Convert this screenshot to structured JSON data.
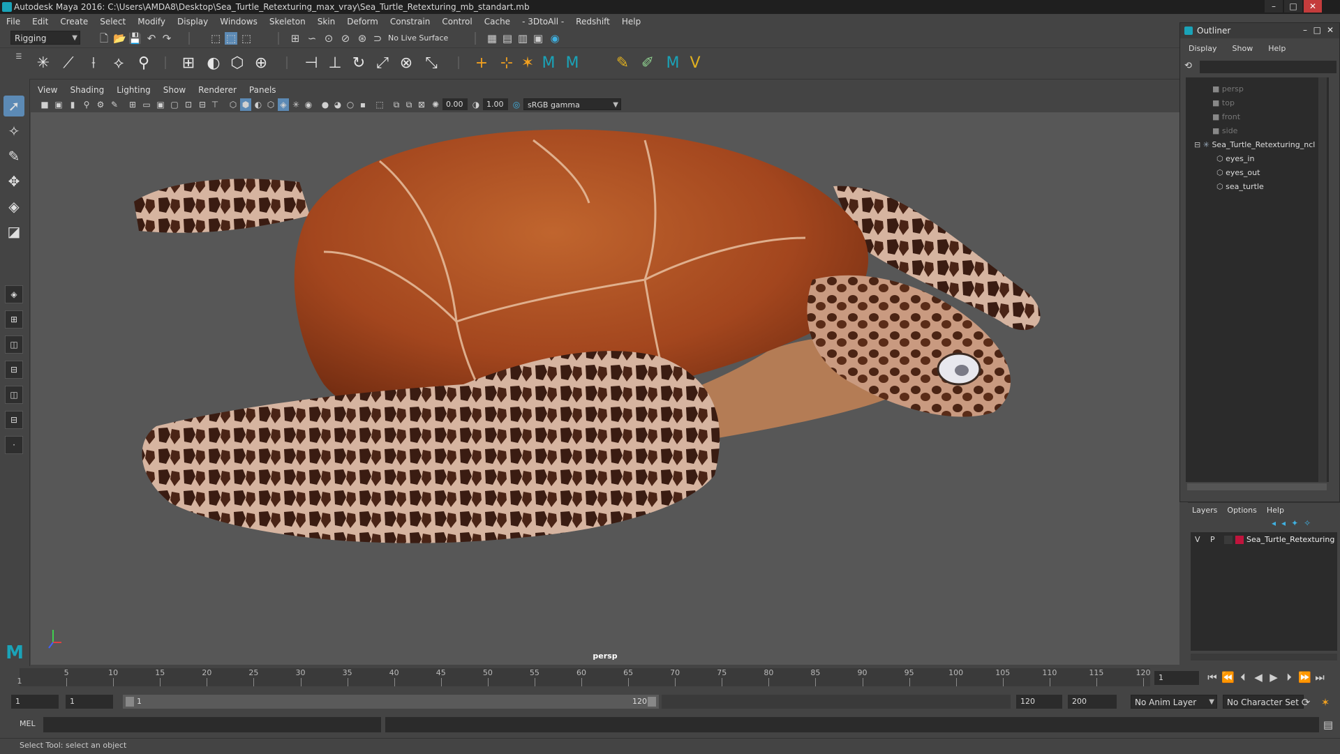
{
  "window": {
    "title": "Autodesk Maya 2016: C:\\Users\\AMDA8\\Desktop\\Sea_Turtle_Retexturing_max_vray\\Sea_Turtle_Retexturing_mb_standart.mb",
    "minimize": "–",
    "maximize": "□",
    "close": "✕"
  },
  "menubar": [
    "File",
    "Edit",
    "Create",
    "Select",
    "Modify",
    "Display",
    "Windows",
    "Skeleton",
    "Skin",
    "Deform",
    "Constrain",
    "Control",
    "Cache",
    "- 3DtoAll -",
    "Redshift",
    "Help"
  ],
  "statusline": {
    "menuset": "Rigging",
    "live_surface": "No Live Surface"
  },
  "viewport": {
    "menu": [
      "View",
      "Shading",
      "Lighting",
      "Show",
      "Renderer",
      "Panels"
    ],
    "exposure": "0.00",
    "gamma": "1.00",
    "colorspace": "sRGB gamma",
    "camera_label": "persp"
  },
  "timeline": {
    "ticks": [
      5,
      10,
      15,
      20,
      25,
      30,
      35,
      40,
      45,
      50,
      55,
      60,
      65,
      70,
      75,
      80,
      85,
      90,
      95,
      100,
      105,
      110,
      115,
      120
    ],
    "start_label": "1",
    "current_frame": "1"
  },
  "range": {
    "start": "1",
    "playback_start": "1",
    "range_start_label": "1",
    "range_end_label": "120",
    "playback_end": "120",
    "end": "200",
    "anim_layer": "No Anim Layer",
    "character_set": "No Character Set"
  },
  "commandline": {
    "label": "MEL"
  },
  "helpline": {
    "text": "Select Tool: select an object"
  },
  "outliner": {
    "title": "Outliner",
    "menu": [
      "Display",
      "Show",
      "Help"
    ],
    "items": [
      {
        "label": "persp",
        "type": "camera",
        "dim": true
      },
      {
        "label": "top",
        "type": "camera",
        "dim": true
      },
      {
        "label": "front",
        "type": "camera",
        "dim": true
      },
      {
        "label": "side",
        "type": "camera",
        "dim": true
      },
      {
        "label": "Sea_Turtle_Retexturing_ncl",
        "type": "group",
        "dim": false
      },
      {
        "label": "eyes_in",
        "type": "mesh",
        "dim": false
      },
      {
        "label": "eyes_out",
        "type": "mesh",
        "dim": false
      },
      {
        "label": "sea_turtle",
        "type": "mesh",
        "dim": false
      }
    ]
  },
  "layers": {
    "menu": [
      "Layers",
      "Options",
      "Help"
    ],
    "row": {
      "v": "V",
      "p": "P",
      "name": "Sea_Turtle_Retexturing",
      "color": "#c0143c"
    }
  }
}
